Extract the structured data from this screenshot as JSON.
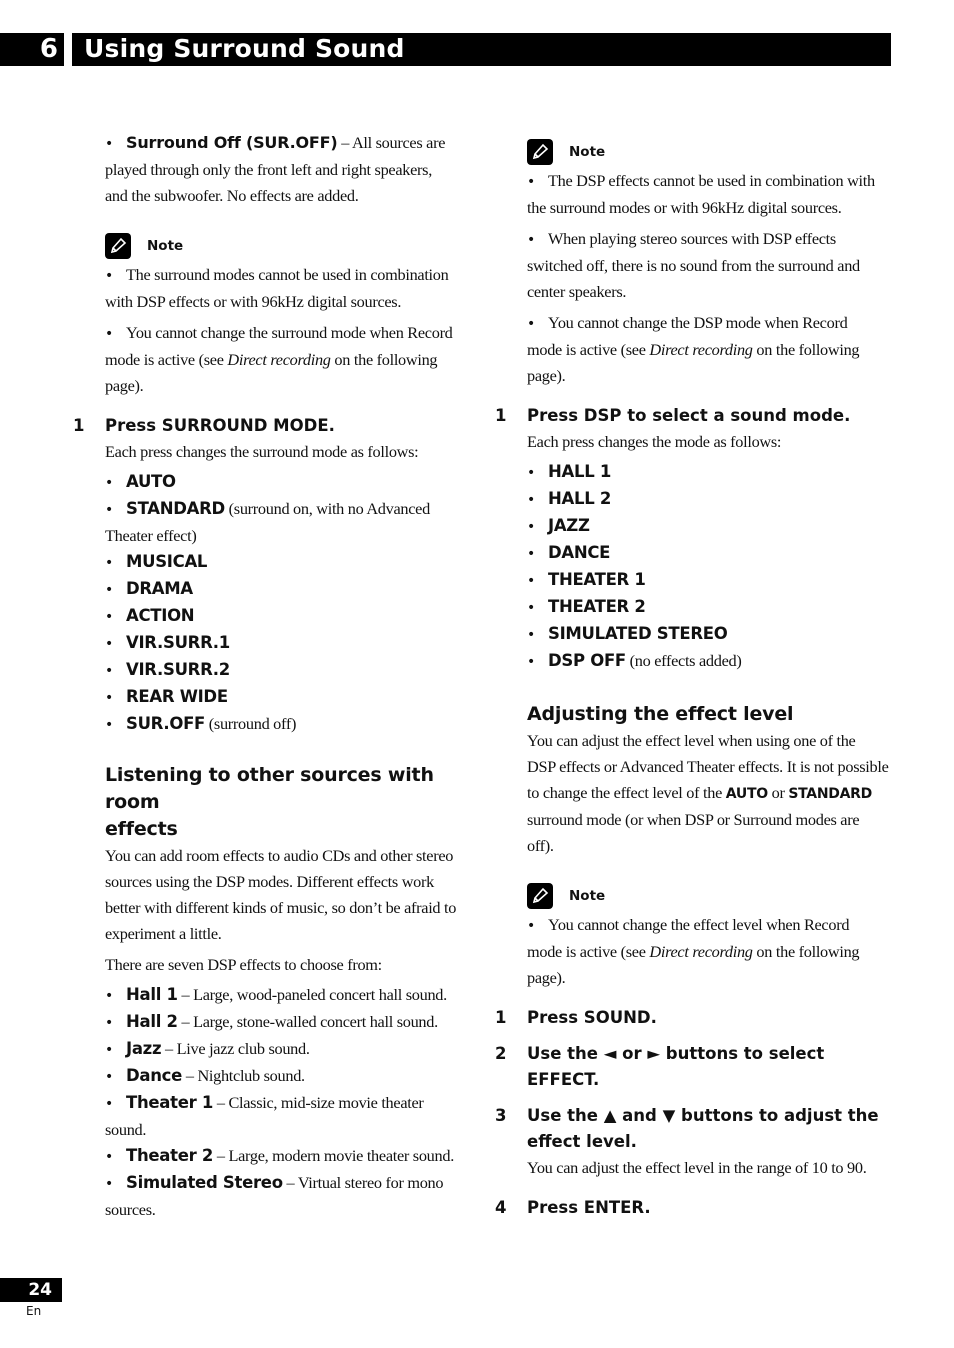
{
  "header": {
    "chapter_number": "6",
    "chapter_title": "Using Surround Sound"
  },
  "left": {
    "surround_off": {
      "label": "Surround Off (SUR.OFF)",
      "lines": [
        " – All sources are",
        "played through only the front left and right speakers,",
        "and the subwoofer. No effects are added."
      ]
    },
    "note1": {
      "label": "Note",
      "b1_lines": [
        "The surround modes cannot be used in combination",
        "with DSP effects or with 96kHz digital sources."
      ],
      "b2_line1": "You cannot change the surround mode when Record",
      "b2_pre": "mode is active (see ",
      "b2_italic": "Direct recording",
      "b2_post": " on the following",
      "b2_line3": "page)."
    },
    "step1": {
      "number": "1",
      "title": "Press SURROUND MODE.",
      "desc": "Each press changes the surround mode as follows:",
      "modes": [
        {
          "name": "AUTO",
          "note": ""
        },
        {
          "name": "STANDARD",
          "note": " (surround on, with no Advanced",
          "note_cont": "Theater effect)"
        },
        {
          "name": "MUSICAL",
          "note": ""
        },
        {
          "name": "DRAMA",
          "note": ""
        },
        {
          "name": "ACTION",
          "note": ""
        },
        {
          "name": "VIR.SURR.1",
          "note": ""
        },
        {
          "name": "VIR.SURR.2",
          "note": ""
        },
        {
          "name": "REAR WIDE",
          "note": ""
        },
        {
          "name": "SUR.OFF",
          "note": " (surround off)"
        }
      ]
    },
    "section2": {
      "heading_line1": "Listening to other sources with room",
      "heading_line2": "effects",
      "para_lines": [
        "You can add room effects to audio CDs and other stereo",
        "sources using the DSP modes. Different effects work",
        "better with different kinds of music, so don’t be afraid to",
        "experiment a little."
      ],
      "intro": "There are seven DSP effects to choose from:",
      "effects": [
        {
          "name": "Hall 1",
          "desc": " – Large, wood-paneled concert hall sound."
        },
        {
          "name": "Hall 2",
          "desc": " – Large, stone-walled concert hall sound."
        },
        {
          "name": "Jazz",
          "desc": " – Live jazz club sound."
        },
        {
          "name": "Dance",
          "desc": " – Nightclub sound."
        },
        {
          "name": "Theater 1",
          "desc": " – Classic, mid-size movie theater",
          "desc_cont": "sound."
        },
        {
          "name": "Theater 2",
          "desc": " – Large, modern movie theater sound."
        },
        {
          "name": "Simulated Stereo",
          "desc": " – Virtual stereo for mono",
          "desc_cont": "sources."
        }
      ]
    }
  },
  "right": {
    "note2": {
      "label": "Note",
      "b1_lines": [
        "The DSP effects cannot be used in combination with",
        "the surround modes or with 96kHz digital sources."
      ],
      "b2_lines": [
        "When playing stereo sources with DSP effects",
        "switched off, there is no sound from the surround and",
        "center speakers."
      ],
      "b3_line1": "You cannot change the DSP mode when Record",
      "b3_pre": "mode is active (see ",
      "b3_italic": "Direct recording",
      "b3_post": " on the following",
      "b3_line3": "page)."
    },
    "step1": {
      "number": "1",
      "title": "Press DSP to select a sound mode.",
      "desc": "Each press changes the mode as follows:",
      "modes": [
        {
          "name": "HALL 1",
          "note": ""
        },
        {
          "name": "HALL 2",
          "note": ""
        },
        {
          "name": "JAZZ",
          "note": ""
        },
        {
          "name": "DANCE",
          "note": ""
        },
        {
          "name": "THEATER 1",
          "note": ""
        },
        {
          "name": "THEATER 2",
          "note": ""
        },
        {
          "name": "SIMULATED STEREO",
          "note": ""
        },
        {
          "name": "DSP OFF",
          "note": " (no effects added)"
        }
      ]
    },
    "section3": {
      "heading": "Adjusting the effect level",
      "para_line1": "You can adjust the effect level when using one of the",
      "para_line2": "DSP effects or Advanced Theater effects. It is not possible",
      "para_line3_pre": "to change the effect level of the ",
      "para_line3_auto": "AUTO",
      "para_line3_or": " or ",
      "para_line3_std": "STANDARD",
      "para_line4": "surround mode (or when DSP or Surround modes are",
      "para_line5": "off)."
    },
    "note3": {
      "label": "Note",
      "b1_line1": "You cannot change the effect level when Record",
      "b1_pre": "mode is active (see ",
      "b1_italic": "Direct recording",
      "b1_post": " on the following",
      "b1_line3": "page)."
    },
    "steps": [
      {
        "number": "1",
        "text": "Press SOUND."
      },
      {
        "number": "2",
        "text": "Use the ◄ or ► buttons to select EFFECT."
      },
      {
        "number": "3",
        "text_line1": "Use the ▲ and ▼ buttons to adjust the",
        "text_line2": "effect level.",
        "desc": "You can adjust the effect level in the range of 10 to 90."
      },
      {
        "number": "4",
        "text": "Press ENTER."
      }
    ]
  },
  "footer": {
    "page_number": "24",
    "language": "En"
  },
  "icons": {
    "note": "pencil-note-icon",
    "bullet": "•"
  }
}
